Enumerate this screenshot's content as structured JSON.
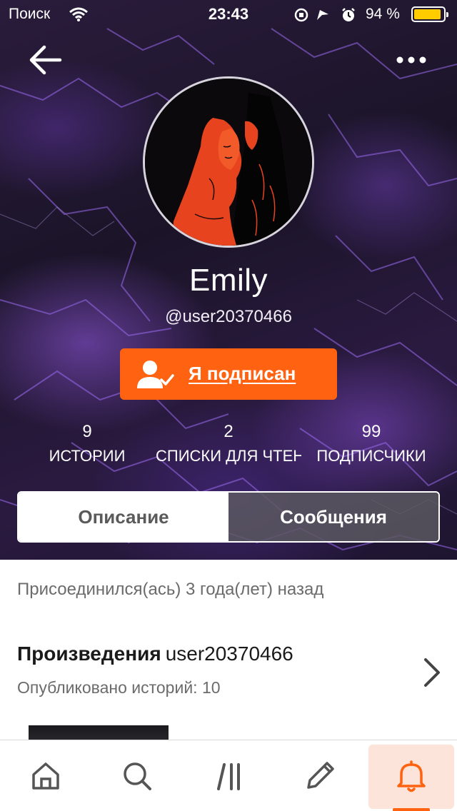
{
  "status_bar": {
    "carrier": "Поиск",
    "time": "23:43",
    "battery_percent": "94 %",
    "battery_level": 0.94,
    "battery_color": "#ffcc00",
    "icons": [
      "wifi-icon",
      "orientation-lock-icon",
      "location-icon",
      "alarm-icon",
      "battery-icon"
    ]
  },
  "header": {
    "back_icon": "arrow-left-icon",
    "more_icon": "ellipsis-icon"
  },
  "profile": {
    "display_name": "Emily",
    "username": "@user20370466",
    "follow_button_label": "Я подписан",
    "follow_icon": "user-check-icon",
    "accent_color": "#ff6210"
  },
  "stats": [
    {
      "value": "9",
      "label": "ИСТОРИИ"
    },
    {
      "value": "2",
      "label": "СПИСКИ ДЛЯ ЧТЕНИЯ"
    },
    {
      "value": "99",
      "label": "ПОДПИСЧИКИ"
    }
  ],
  "tabs": [
    {
      "label": "Описание",
      "selected": false
    },
    {
      "label": "Сообщения",
      "selected": true
    }
  ],
  "about": {
    "joined_text": "Присоединился(ась) 3 года(лет) назад"
  },
  "works": {
    "title": "Произведения",
    "title_user": "user20370466",
    "subtitle": "Опубликовано историй: 10",
    "chevron_icon": "chevron-right-icon"
  },
  "tab_bar": {
    "items": [
      {
        "name": "home",
        "icon": "home-icon",
        "active": false
      },
      {
        "name": "search",
        "icon": "search-icon",
        "active": false
      },
      {
        "name": "library",
        "icon": "library-icon",
        "active": false
      },
      {
        "name": "write",
        "icon": "pencil-icon",
        "active": false
      },
      {
        "name": "notifications",
        "icon": "bell-icon",
        "active": true
      }
    ]
  }
}
